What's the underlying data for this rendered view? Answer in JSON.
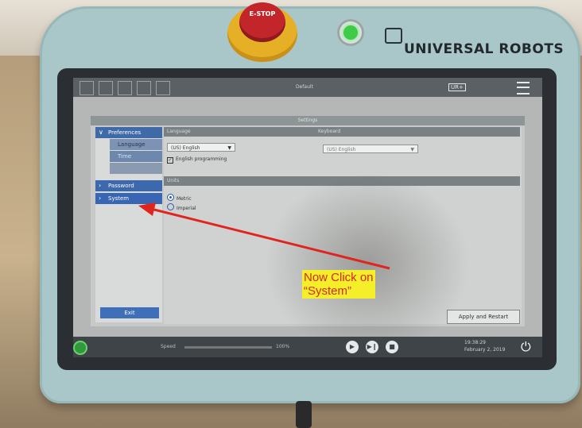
{
  "device": {
    "estop_label": "E-STOP",
    "brand": "UNIVERSAL ROBOTS"
  },
  "screen": {
    "topbar": {
      "program": "Default",
      "logo": "UR+"
    },
    "dialog": {
      "title": "Settings",
      "sidebar": {
        "items": [
          {
            "label": "Preferences",
            "expanded": true
          },
          {
            "label": "Language",
            "sub": true
          },
          {
            "label": "Time",
            "sub": true
          },
          {
            "label": "Password"
          },
          {
            "label": "System"
          }
        ],
        "exit_label": "Exit"
      },
      "language_section": {
        "header": "Language",
        "dropdown_value": "(US) English",
        "checkbox_label": "English programming",
        "checked": true
      },
      "keyboard_section": {
        "header": "Keyboard",
        "dropdown_value": "(US) English"
      },
      "units_section": {
        "header": "Units",
        "options": [
          "Metric",
          "Imperial"
        ],
        "selected": "Metric"
      },
      "apply_label": "Apply and Restart"
    },
    "statusbar": {
      "speed_label": "Speed",
      "speed_value": "100%",
      "time": "19:38:29",
      "date": "February 2, 2019"
    }
  },
  "annotation": {
    "line1": "Now Click on",
    "line2": "“System”"
  },
  "colors": {
    "accent_blue": "#3966b4",
    "annotation_bg": "#f5ef2a",
    "annotation_text": "#d8261f",
    "arrow": "#e0241e",
    "estop": "#c3262a"
  }
}
